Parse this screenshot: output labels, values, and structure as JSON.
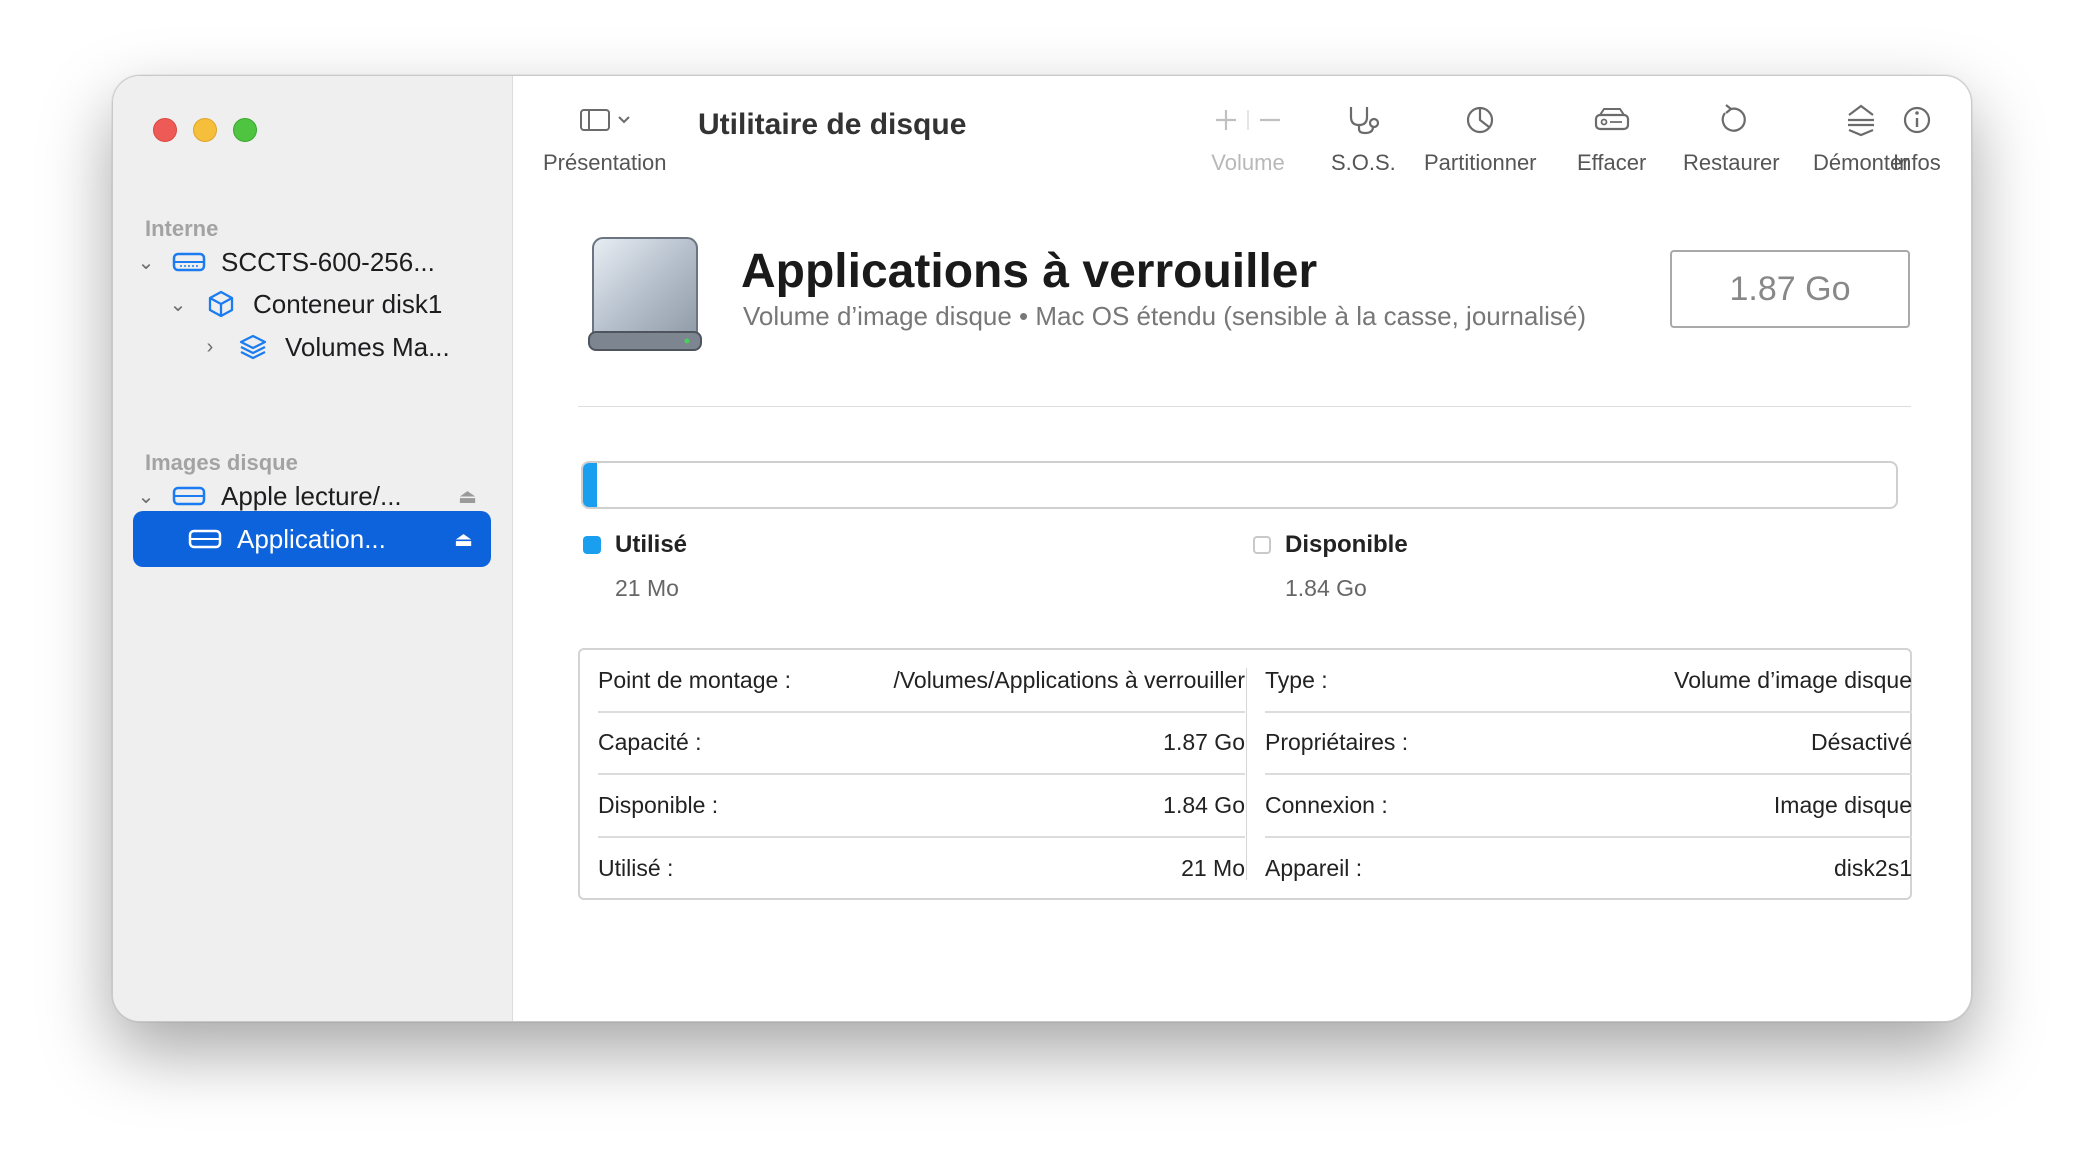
{
  "window": {
    "title": "Utilitaire de disque"
  },
  "sidebar": {
    "sections": [
      {
        "label": "Interne"
      },
      {
        "label": "Images disque"
      }
    ],
    "items": [
      {
        "label": "SCCTS-600-256...",
        "icon": "internal-disk-icon"
      },
      {
        "label": "Conteneur disk1",
        "icon": "container-cube-icon"
      },
      {
        "label": "Volumes Ma...",
        "icon": "layers-stack-icon"
      },
      {
        "label": "Apple lecture/...",
        "icon": "disk-image-icon"
      },
      {
        "label": "Application...",
        "icon": "volume-disk-icon",
        "selected": true
      }
    ]
  },
  "toolbar": {
    "presentation_label": "Présentation",
    "volume_label": "Volume",
    "sos_label": "S.O.S.",
    "partition_label": "Partitionner",
    "erase_label": "Effacer",
    "restore_label": "Restaurer",
    "unmount_label": "Démonter",
    "info_label": "Infos"
  },
  "volume": {
    "name": "Applications à verrouiller",
    "subtitle": "Volume d’image disque • Mac OS étendu (sensible à la casse, journalisé)",
    "size": "1.87 Go",
    "used_fraction": 0.011,
    "used_label": "Utilisé",
    "used_value": "21 Mo",
    "free_label": "Disponible",
    "free_value": "1.84 Go",
    "used_color": "#1a9ef0"
  },
  "info": {
    "left": [
      {
        "k": "Point de montage :",
        "v": "/Volumes/Applications à verrouiller"
      },
      {
        "k": "Capacité :",
        "v": "1.87 Go"
      },
      {
        "k": "Disponible :",
        "v": "1.84 Go"
      },
      {
        "k": "Utilisé :",
        "v": "21 Mo"
      }
    ],
    "right": [
      {
        "k": "Type :",
        "v": "Volume d’image disque"
      },
      {
        "k": "Propriétaires :",
        "v": "Désactivé"
      },
      {
        "k": "Connexion :",
        "v": "Image disque"
      },
      {
        "k": "Appareil :",
        "v": "disk2s1"
      }
    ]
  }
}
